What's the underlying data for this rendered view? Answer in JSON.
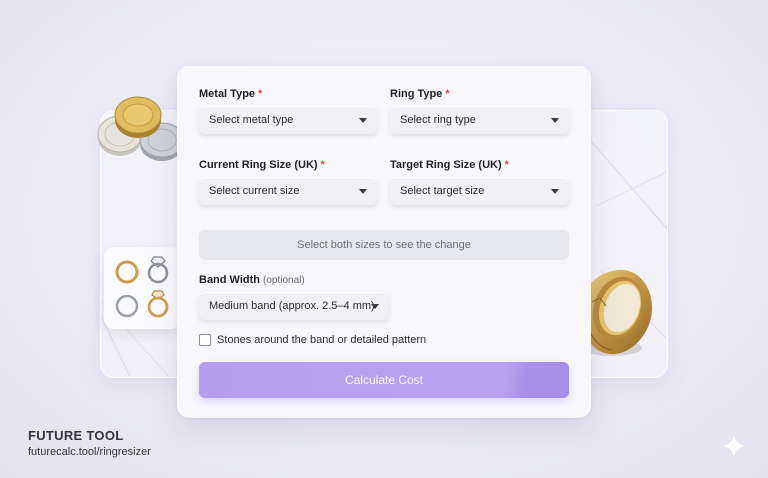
{
  "form": {
    "metal_type": {
      "label": "Metal Type",
      "required": "*",
      "value": "Select metal type"
    },
    "ring_type": {
      "label": "Ring Type",
      "required": "*",
      "value": "Select ring type"
    },
    "current_size": {
      "label": "Current Ring Size (UK)",
      "required": "*",
      "value": "Select current size"
    },
    "target_size": {
      "label": "Target Ring Size (UK)",
      "required": "*",
      "value": "Select target size"
    },
    "size_change_info": "Select both sizes to see the change",
    "band_width": {
      "label": "Band Width",
      "optional": "(optional)",
      "value": "Medium band (approx. 2.5–4 mm)"
    },
    "stones_checkbox": {
      "label": "Stones around the band or detailed pattern",
      "checked": false
    },
    "submit_label": "Calculate Cost"
  },
  "colors": {
    "accent": "#b49ef0",
    "required": "#e04848",
    "gold": "#c9a24e"
  },
  "decorations": {
    "coins": "gold-silver-coins",
    "ring_icons": [
      "gold-ring-icon",
      "diamond-ring-icon",
      "silver-ring-icon",
      "gold-solitaire-ring-icon"
    ],
    "ring_photo": "gold-band-ring",
    "sparkle": "sparkle-icon"
  },
  "footer": {
    "brand": "FUTURE TOOL",
    "url": "futurecalc.tool/ringresizer"
  }
}
